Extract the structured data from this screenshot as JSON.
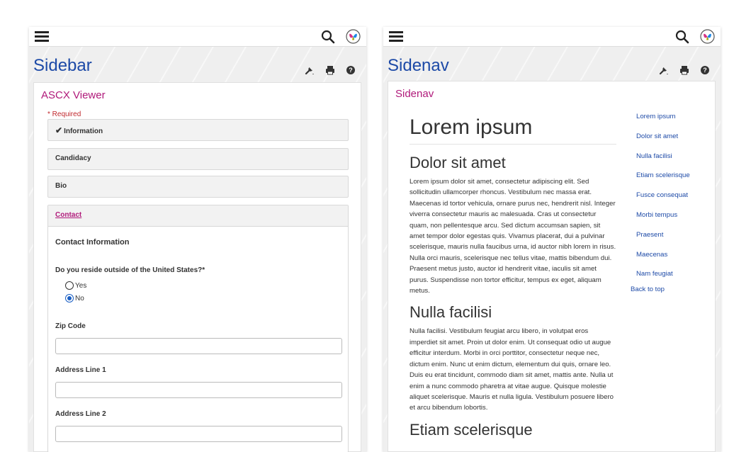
{
  "colors": {
    "title": "#1d4aa7",
    "accent": "#b0197a",
    "required": "#c0282d",
    "radio_selected": "#1a5fc4"
  },
  "left": {
    "page_title": "Sidebar",
    "card_title": "ASCX Viewer",
    "required": "* Required",
    "sections": [
      "Information",
      "Candidacy",
      "Bio",
      "Contact"
    ],
    "check_icon": "checkmark-icon",
    "contact": {
      "heading": "Contact Information",
      "question": "Do you reside outside of the United States?*",
      "options": [
        "Yes",
        "No"
      ],
      "selected": "No",
      "fields": [
        "Zip Code",
        "Address Line 1",
        "Address Line 2"
      ]
    }
  },
  "right": {
    "page_title": "Sidenav",
    "card_title": "Sidenav",
    "h1": "Lorem ipsum",
    "h2_1": "Dolor sit amet",
    "p1": "Lorem ipsum dolor sit amet, consectetur adipiscing elit. Sed sollicitudin ullamcorper rhoncus. Vestibulum nec massa erat. Maecenas id tortor vehicula, ornare purus nec, hendrerit nisl. Integer viverra consectetur mauris ac malesuada. Cras ut consectetur quam, non pellentesque arcu. Sed dictum accumsan sapien, sit amet tempor dolor egestas quis. Vivamus placerat, dui a pulvinar scelerisque, mauris nulla faucibus urna, id auctor nibh lorem in risus. Nulla orci mauris, scelerisque nec tellus vitae, mattis bibendum dui. Praesent metus justo, auctor id hendrerit vitae, iaculis sit amet purus. Suspendisse non tortor efficitur, tempus ex eget, aliquam metus.",
    "h2_2": "Nulla facilisi",
    "p2": "Nulla facilisi. Vestibulum feugiat arcu libero, in volutpat eros imperdiet sit amet. Proin ut dolor enim. Ut consequat odio ut augue efficitur interdum. Morbi in orci porttitor, consectetur neque nec, dictum enim. Nunc ut enim dictum, elementum dui quis, ornare leo. Duis eu erat tincidunt, commodo diam sit amet, mattis ante. Nulla ut enim a nunc commodo pharetra at vitae augue. Quisque molestie aliquet scelerisque. Mauris et nulla ligula. Vestibulum posuere libero et arcu bibendum lobortis.",
    "h2_3": "Etiam scelerisque",
    "toc": [
      "Lorem ipsum",
      "Dolor sit amet",
      "Nulla facilisi",
      "Etiam scelerisque",
      "Fusce consequat",
      "Morbi tempus",
      "Praesent",
      "Maecenas",
      "Nam feugiat"
    ],
    "back_to_top": "Back to top"
  }
}
